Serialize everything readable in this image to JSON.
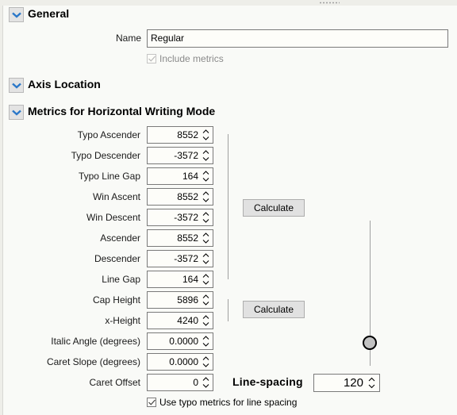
{
  "sections": {
    "general": {
      "title": "General",
      "expanded": true
    },
    "axis_location": {
      "title": "Axis Location",
      "expanded": true
    },
    "metrics": {
      "title": "Metrics for Horizontal Writing Mode",
      "expanded": true
    }
  },
  "general": {
    "name_label": "Name",
    "name_value": "Regular",
    "include_metrics_label": "Include metrics",
    "include_metrics_checked": true,
    "include_metrics_enabled": false
  },
  "metrics": {
    "fields": [
      {
        "label": "Typo Ascender",
        "value": "8552"
      },
      {
        "label": "Typo Descender",
        "value": "-3572"
      },
      {
        "label": "Typo Line Gap",
        "value": "164"
      },
      {
        "label": "Win Ascent",
        "value": "8552"
      },
      {
        "label": "Win Descent",
        "value": "-3572"
      },
      {
        "label": "Ascender",
        "value": "8552"
      },
      {
        "label": "Descender",
        "value": "-3572"
      },
      {
        "label": "Line Gap",
        "value": "164"
      },
      {
        "label": "Cap Height",
        "value": "5896"
      },
      {
        "label": "x-Height",
        "value": "4240"
      },
      {
        "label": "Italic Angle (degrees)",
        "value": "0.0000"
      },
      {
        "label": "Caret Slope (degrees)",
        "value": "0.0000"
      },
      {
        "label": "Caret Offset",
        "value": "0"
      }
    ],
    "calculate_button_1": "Calculate",
    "calculate_button_2": "Calculate",
    "use_typo_metrics_label": "Use typo metrics for line spacing",
    "use_typo_metrics_checked": true,
    "line_spacing_label": "Line-spacing",
    "line_spacing_value": "120",
    "line_spacing_slider_fraction": 0.16
  },
  "icons": {
    "section_toggle": "chevron-down-icon",
    "spinner": "up-down-arrows-icon",
    "checkbox": "checkmark-icon"
  }
}
